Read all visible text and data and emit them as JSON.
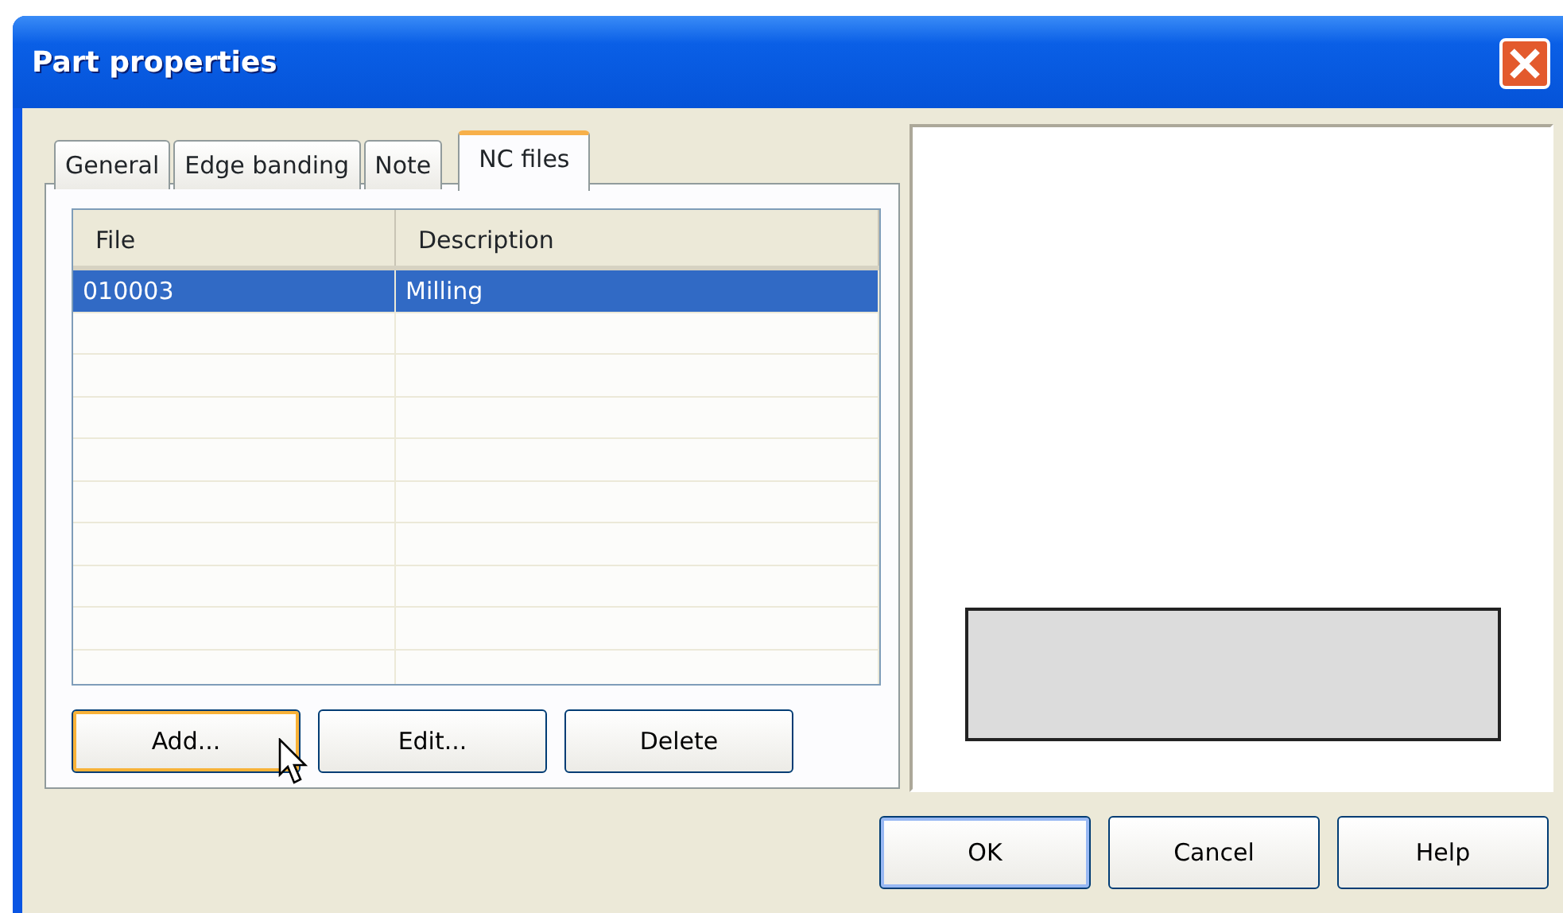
{
  "window": {
    "title": "Part properties"
  },
  "tabs": [
    {
      "label": "General",
      "selected": false
    },
    {
      "label": "Edge banding",
      "selected": false
    },
    {
      "label": "Note",
      "selected": false
    },
    {
      "label": "NC files",
      "selected": true
    }
  ],
  "table": {
    "columns": [
      "File",
      "Description"
    ],
    "rows": [
      {
        "cells": [
          "010003",
          "Milling"
        ],
        "selected": true
      }
    ]
  },
  "panel_buttons": [
    {
      "label": "Add...",
      "hot": true
    },
    {
      "label": "Edit...",
      "hot": false
    },
    {
      "label": "Delete",
      "hot": false
    }
  ],
  "dialog_buttons": [
    {
      "label": "OK",
      "default": true
    },
    {
      "label": "Cancel",
      "default": false
    },
    {
      "label": "Help",
      "default": false
    }
  ]
}
